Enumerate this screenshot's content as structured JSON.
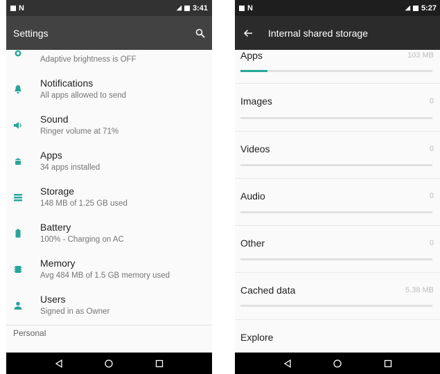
{
  "colors": {
    "accent": "#26a69a",
    "left_toolbar": "#424242",
    "left_statusbar": "#323232",
    "right_toolbar": "#2b2b2b",
    "right_statusbar": "#1e1e1e"
  },
  "left_screen": {
    "status_bar": {
      "time": "3:41"
    },
    "toolbar": {
      "title": "Settings",
      "search_icon": "search-icon"
    },
    "items": [
      {
        "name": "display",
        "icon": "brightness-icon",
        "title": "",
        "subtitle": "Adaptive brightness is OFF"
      },
      {
        "name": "notifications",
        "icon": "bell-icon",
        "title": "Notifications",
        "subtitle": "All apps allowed to send"
      },
      {
        "name": "sound",
        "icon": "volume-icon",
        "title": "Sound",
        "subtitle": "Ringer volume at 71%"
      },
      {
        "name": "apps",
        "icon": "android-icon",
        "title": "Apps",
        "subtitle": "34 apps installed"
      },
      {
        "name": "storage",
        "icon": "storage-icon",
        "title": "Storage",
        "subtitle": "148 MB of 1.25 GB used"
      },
      {
        "name": "battery",
        "icon": "battery-icon",
        "title": "Battery",
        "subtitle": "100% - Charging on AC"
      },
      {
        "name": "memory",
        "icon": "memory-icon",
        "title": "Memory",
        "subtitle": "Avg 484 MB of 1.5 GB memory used"
      },
      {
        "name": "users",
        "icon": "person-icon",
        "title": "Users",
        "subtitle": "Signed in as Owner"
      }
    ],
    "section_header": "Personal"
  },
  "right_screen": {
    "status_bar": {
      "time": "5:27"
    },
    "toolbar": {
      "title": "Internal shared storage",
      "back_icon": "arrow-back-icon"
    },
    "items": [
      {
        "name": "apps",
        "label": "Apps",
        "value": "103 MB",
        "usage_fraction": 0.14
      },
      {
        "name": "images",
        "label": "Images",
        "value": "0",
        "usage_fraction": 0
      },
      {
        "name": "videos",
        "label": "Videos",
        "value": "0",
        "usage_fraction": 0
      },
      {
        "name": "audio",
        "label": "Audio",
        "value": "0",
        "usage_fraction": 0
      },
      {
        "name": "other",
        "label": "Other",
        "value": "0",
        "usage_fraction": 0
      },
      {
        "name": "cached-data",
        "label": "Cached data",
        "value": "5.38 MB",
        "usage_fraction": 0
      }
    ],
    "explore_label": "Explore"
  },
  "navigation_bar": {
    "buttons": [
      "back-triangle-icon",
      "home-circle-icon",
      "recents-square-icon"
    ]
  }
}
